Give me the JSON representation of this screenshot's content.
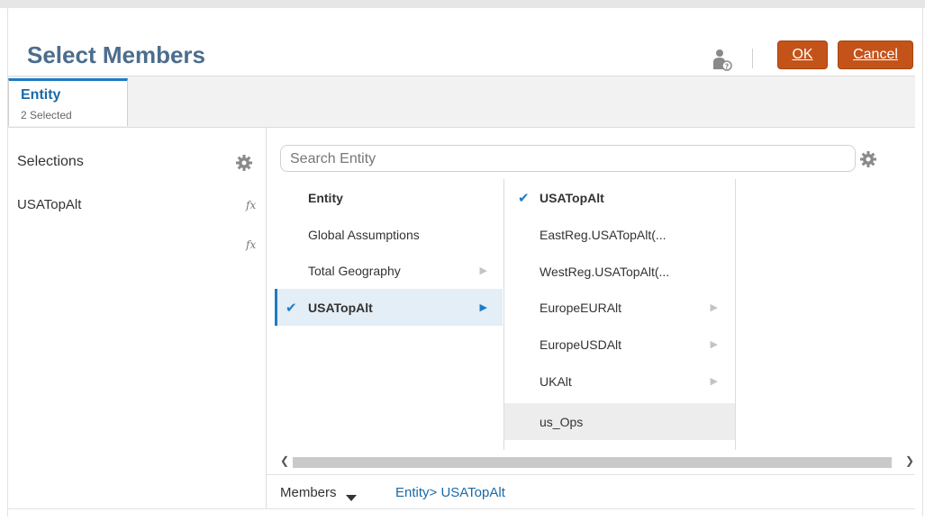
{
  "dialog": {
    "title": "Select Members",
    "help_icon": "user-help-icon",
    "ok_label": "OK",
    "cancel_label": "Cancel"
  },
  "tab": {
    "title": "Entity",
    "subtitle": "2 Selected"
  },
  "selections": {
    "label": "Selections",
    "items": [
      {
        "label": "USATopAlt"
      }
    ],
    "fx_label": "fx"
  },
  "search": {
    "placeholder": "Search Entity"
  },
  "column1": [
    {
      "label": "Entity",
      "bold": true
    },
    {
      "label": "Global Assumptions"
    },
    {
      "label": "Total Geography",
      "has_children": true
    },
    {
      "label": "USATopAlt",
      "bold": true,
      "checked": true,
      "selected": true,
      "has_children": true
    }
  ],
  "column2": [
    {
      "label": "USATopAlt",
      "bold": true,
      "checked": true
    },
    {
      "label": "EastReg.USATopAlt(..."
    },
    {
      "label": "WestReg.USATopAlt(..."
    },
    {
      "label": "EuropeEURAlt",
      "has_children": true
    },
    {
      "label": "EuropeUSDAlt",
      "has_children": true
    },
    {
      "label": "UKAlt",
      "has_children": true
    },
    {
      "label": "us_Ops",
      "highlighted": true
    }
  ],
  "footer": {
    "members_label": "Members",
    "breadcrumb": "Entity> USATopAlt"
  },
  "colors": {
    "accent": "#1f7bc4",
    "button": "#c4531a",
    "title": "#4c6d8d"
  }
}
